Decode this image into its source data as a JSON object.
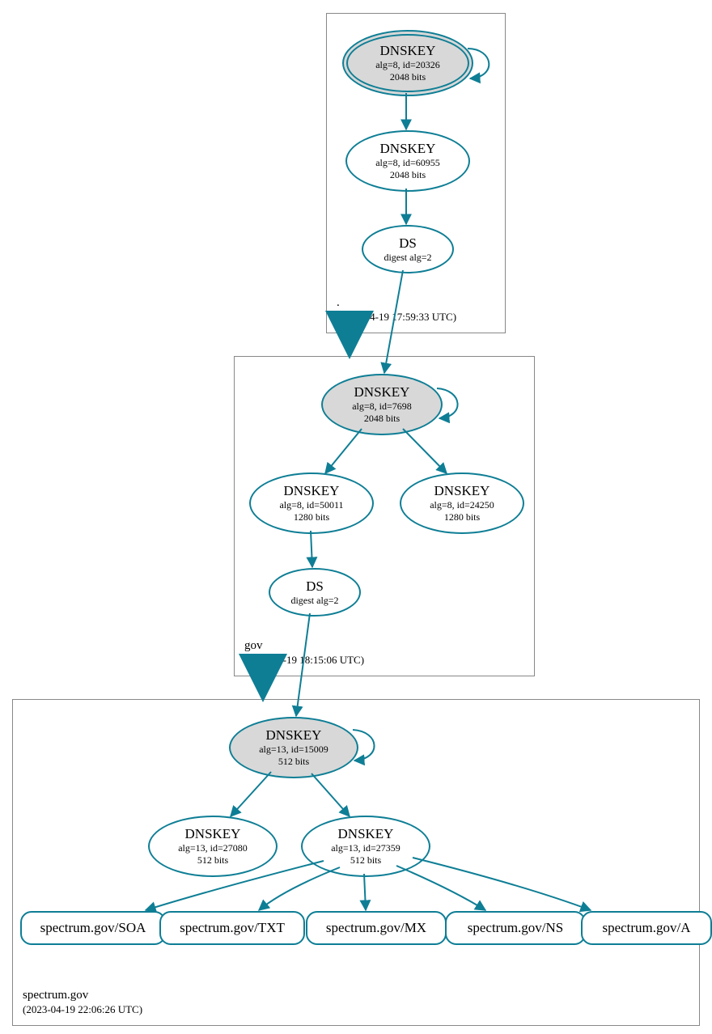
{
  "color_stroke": "#0e7e95",
  "zones": {
    "root": {
      "name": ".",
      "timestamp": "(2023-04-19 17:59:33 UTC)",
      "nodes": {
        "ksk": {
          "title": "DNSKEY",
          "alg": "alg=8, id=20326",
          "bits": "2048 bits"
        },
        "zsk": {
          "title": "DNSKEY",
          "alg": "alg=8, id=60955",
          "bits": "2048 bits"
        },
        "ds": {
          "title": "DS",
          "alg": "digest alg=2"
        }
      }
    },
    "gov": {
      "name": "gov",
      "timestamp": "(2023-04-19 18:15:06 UTC)",
      "nodes": {
        "ksk": {
          "title": "DNSKEY",
          "alg": "alg=8, id=7698",
          "bits": "2048 bits"
        },
        "zsk1": {
          "title": "DNSKEY",
          "alg": "alg=8, id=50011",
          "bits": "1280 bits"
        },
        "zsk2": {
          "title": "DNSKEY",
          "alg": "alg=8, id=24250",
          "bits": "1280 bits"
        },
        "ds": {
          "title": "DS",
          "alg": "digest alg=2"
        }
      }
    },
    "spectrum": {
      "name": "spectrum.gov",
      "timestamp": "(2023-04-19 22:06:26 UTC)",
      "nodes": {
        "ksk": {
          "title": "DNSKEY",
          "alg": "alg=13, id=15009",
          "bits": "512 bits"
        },
        "zsk1": {
          "title": "DNSKEY",
          "alg": "alg=13, id=27080",
          "bits": "512 bits"
        },
        "zsk2": {
          "title": "DNSKEY",
          "alg": "alg=13, id=27359",
          "bits": "512 bits"
        }
      },
      "rr": {
        "soa": "spectrum.gov/SOA",
        "txt": "spectrum.gov/TXT",
        "mx": "spectrum.gov/MX",
        "ns": "spectrum.gov/NS",
        "a": "spectrum.gov/A"
      }
    }
  }
}
